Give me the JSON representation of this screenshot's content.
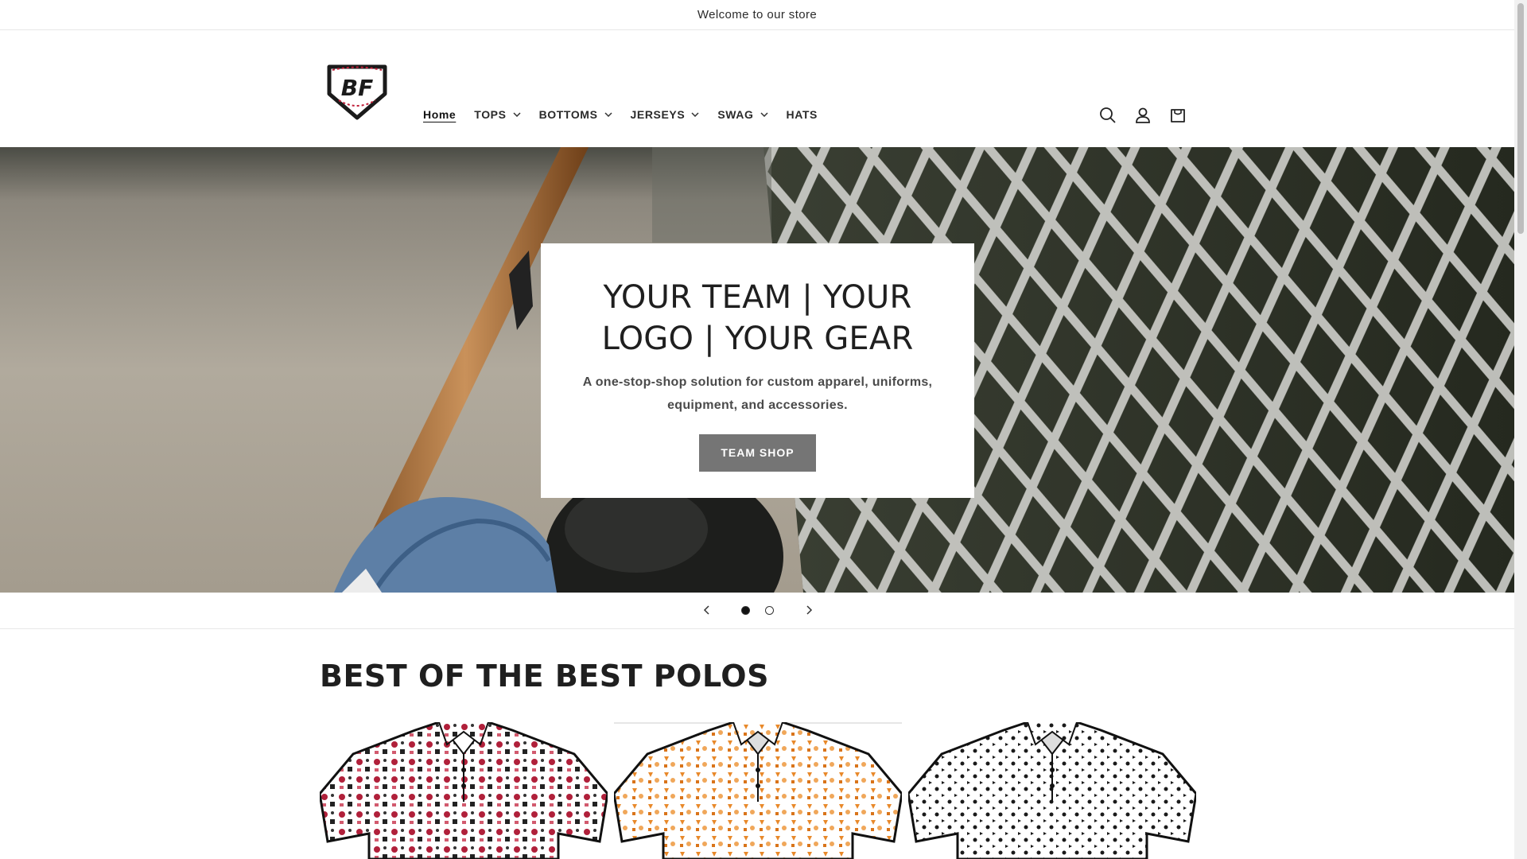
{
  "announcement": {
    "text": "Welcome to our store"
  },
  "header": {
    "logo_text": "BF",
    "nav": [
      {
        "label": "Home",
        "has_dropdown": false,
        "active": true
      },
      {
        "label": "TOPS",
        "has_dropdown": true
      },
      {
        "label": "BOTTOMS",
        "has_dropdown": true
      },
      {
        "label": "JERSEYS",
        "has_dropdown": true
      },
      {
        "label": "SWAG",
        "has_dropdown": true
      },
      {
        "label": "HATS",
        "has_dropdown": false
      }
    ],
    "icons": [
      "search-icon",
      "account-icon",
      "cart-icon"
    ]
  },
  "hero": {
    "title": "YOUR TEAM | YOUR LOGO | YOUR GEAR",
    "subtitle": "A one-stop-shop solution for custom apparel, uniforms, equipment, and accessories.",
    "button_label": "TEAM SHOP",
    "button_color": "#757575"
  },
  "slider": {
    "slide_count": 2,
    "current_slide": 1
  },
  "collection": {
    "title": "BEST OF THE BEST POLOS",
    "products": [
      {
        "pattern_color": "#b0203a"
      },
      {
        "pattern_color": "#e8892a"
      },
      {
        "pattern_color": "#1a1a1a"
      }
    ]
  }
}
